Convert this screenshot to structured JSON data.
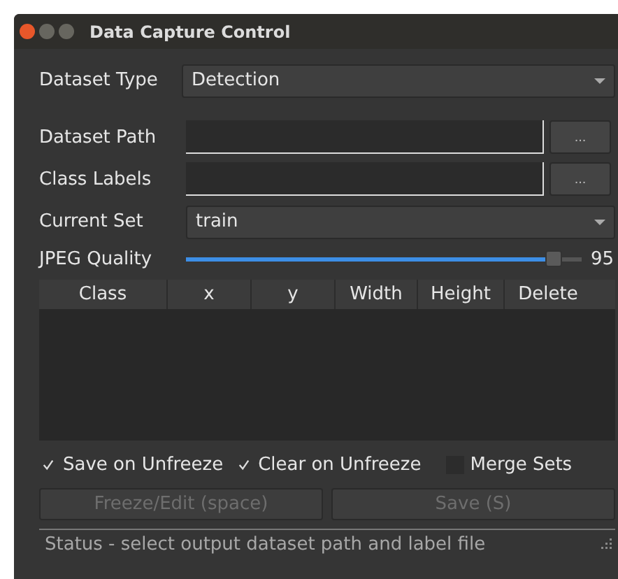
{
  "window": {
    "title": "Data Capture Control"
  },
  "dataset_type": {
    "label": "Dataset Type",
    "value": "Detection"
  },
  "dataset_path": {
    "label": "Dataset Path",
    "button": "..."
  },
  "class_labels": {
    "label": "Class Labels",
    "button": "..."
  },
  "current_set": {
    "label": "Current Set",
    "value": "train"
  },
  "jpeg_quality": {
    "label": "JPEG Quality",
    "level": 0.95,
    "reading": "95"
  },
  "table": {
    "columns": [
      "Class",
      "x",
      "y",
      "Width",
      "Height",
      "Delete"
    ]
  },
  "options": [
    {
      "label": "Save on Unfreeze",
      "checked": true
    },
    {
      "label": "Clear on Unfreeze",
      "checked": true
    },
    {
      "label": "Merge Sets",
      "checked": false
    }
  ],
  "buttons": [
    {
      "label": "Freeze/Edit (space)",
      "disabled": true
    },
    {
      "label": "Save (S)",
      "disabled": true
    }
  ],
  "status_bar": "Status - select output dataset path and label file"
}
